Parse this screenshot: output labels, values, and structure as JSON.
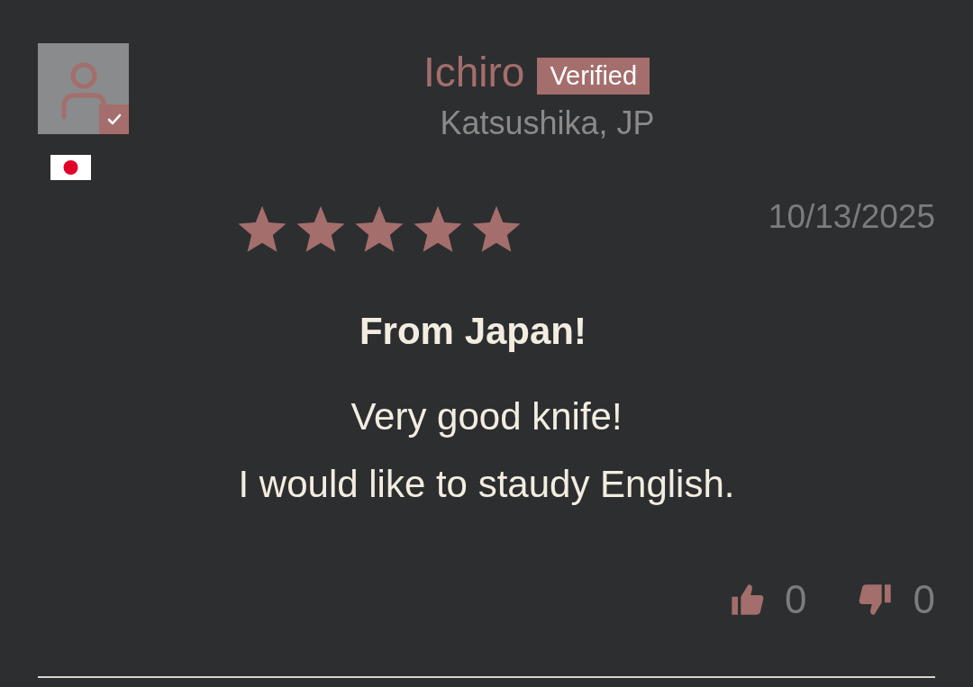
{
  "review": {
    "reviewer": {
      "name": "Ichiro",
      "verified": true,
      "badge": "Verified",
      "location": "Katsushika, JP"
    },
    "stars": 5,
    "date": "10/13/2025",
    "title": "From Japan!",
    "body": [
      "Very good knife!",
      "I would like to staudy English."
    ],
    "votes": [
      {
        "kind": "up",
        "count": "0"
      },
      {
        "kind": "down",
        "count": "0"
      }
    ]
  }
}
